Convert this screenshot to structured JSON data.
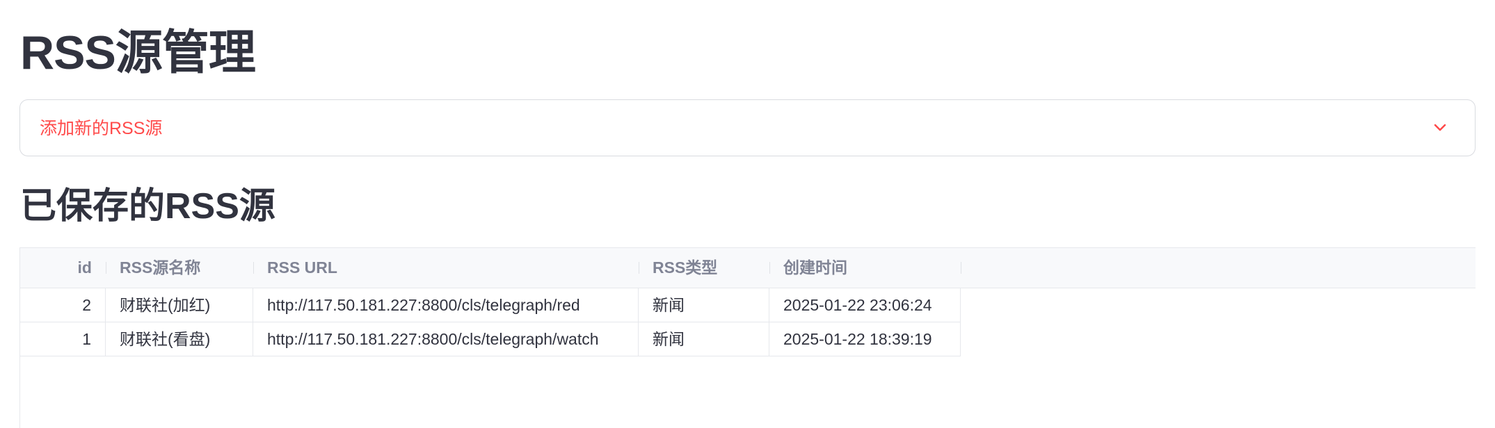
{
  "page_title": "RSS源管理",
  "expander": {
    "label": "添加新的RSS源",
    "icon": "chevron-down-icon",
    "accent_color": "#ff4b4b"
  },
  "section_title": "已保存的RSS源",
  "table": {
    "columns": [
      "id",
      "RSS源名称",
      "RSS URL",
      "RSS类型",
      "创建时间"
    ],
    "rows": [
      [
        "2",
        "财联社(加红)",
        "http://117.50.181.227:8800/cls/telegraph/red",
        "新闻",
        "2025-01-22 23:06:24"
      ],
      [
        "1",
        "财联社(看盘)",
        "http://117.50.181.227:8800/cls/telegraph/watch",
        "新闻",
        "2025-01-22 18:39:19"
      ]
    ]
  }
}
